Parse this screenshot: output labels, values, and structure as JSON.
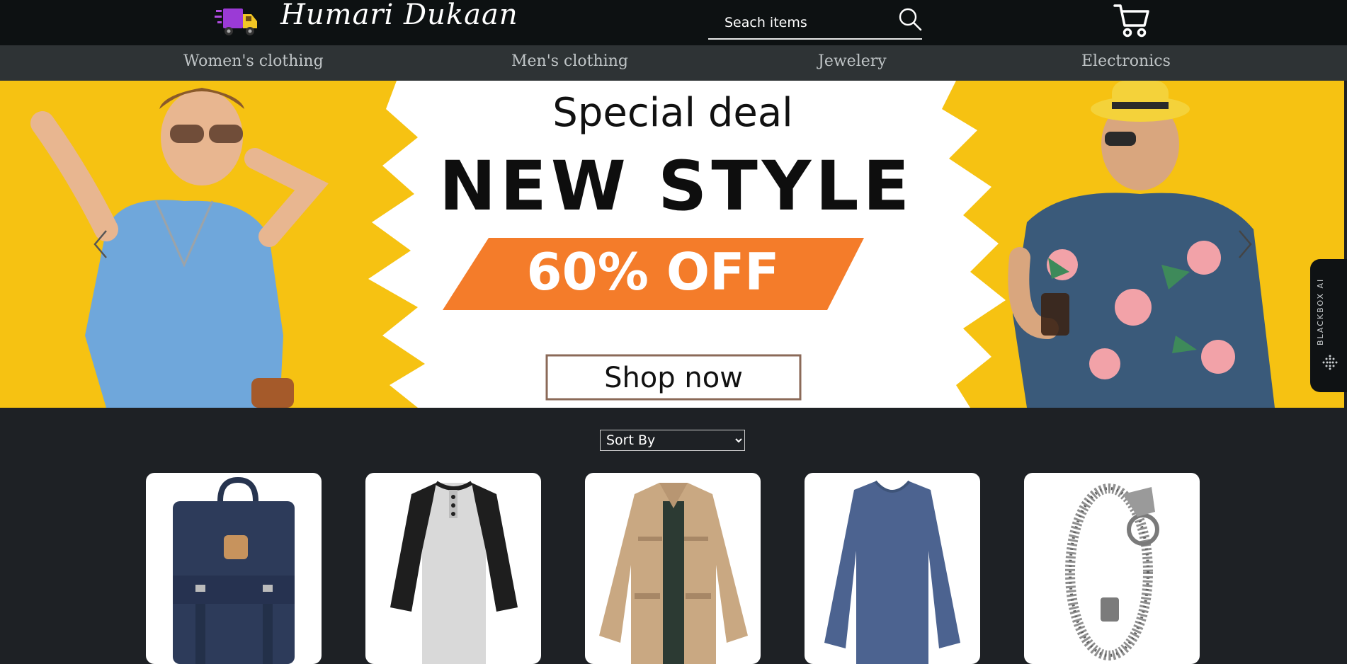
{
  "header": {
    "brand": "Humari Dukaan",
    "search_placeholder": "Seach items",
    "logo_icon": "truck-icon",
    "cart_icon": "cart-icon"
  },
  "categories": [
    "Women's clothing",
    "Men's clothing",
    "Jewelery",
    "Electronics"
  ],
  "banner": {
    "line1": "Special deal",
    "line2": "NEW STYLE",
    "discount": "60% OFF",
    "cta": "Shop now"
  },
  "widget": {
    "label": "BLACKBOX AI"
  },
  "sort": {
    "selected": "Sort By"
  },
  "products": [
    {
      "image": "backpack"
    },
    {
      "image": "henley-raglan-shirt"
    },
    {
      "image": "cotton-jacket"
    },
    {
      "image": "slim-fit-tshirt"
    },
    {
      "image": "chain-bracelet"
    }
  ],
  "colors": {
    "header_bg": "#0d1112",
    "nav_bg": "#2e3335",
    "page_bg": "#1e2125",
    "banner_yellow": "#f6c212",
    "offer_orange": "#f47c2a"
  }
}
